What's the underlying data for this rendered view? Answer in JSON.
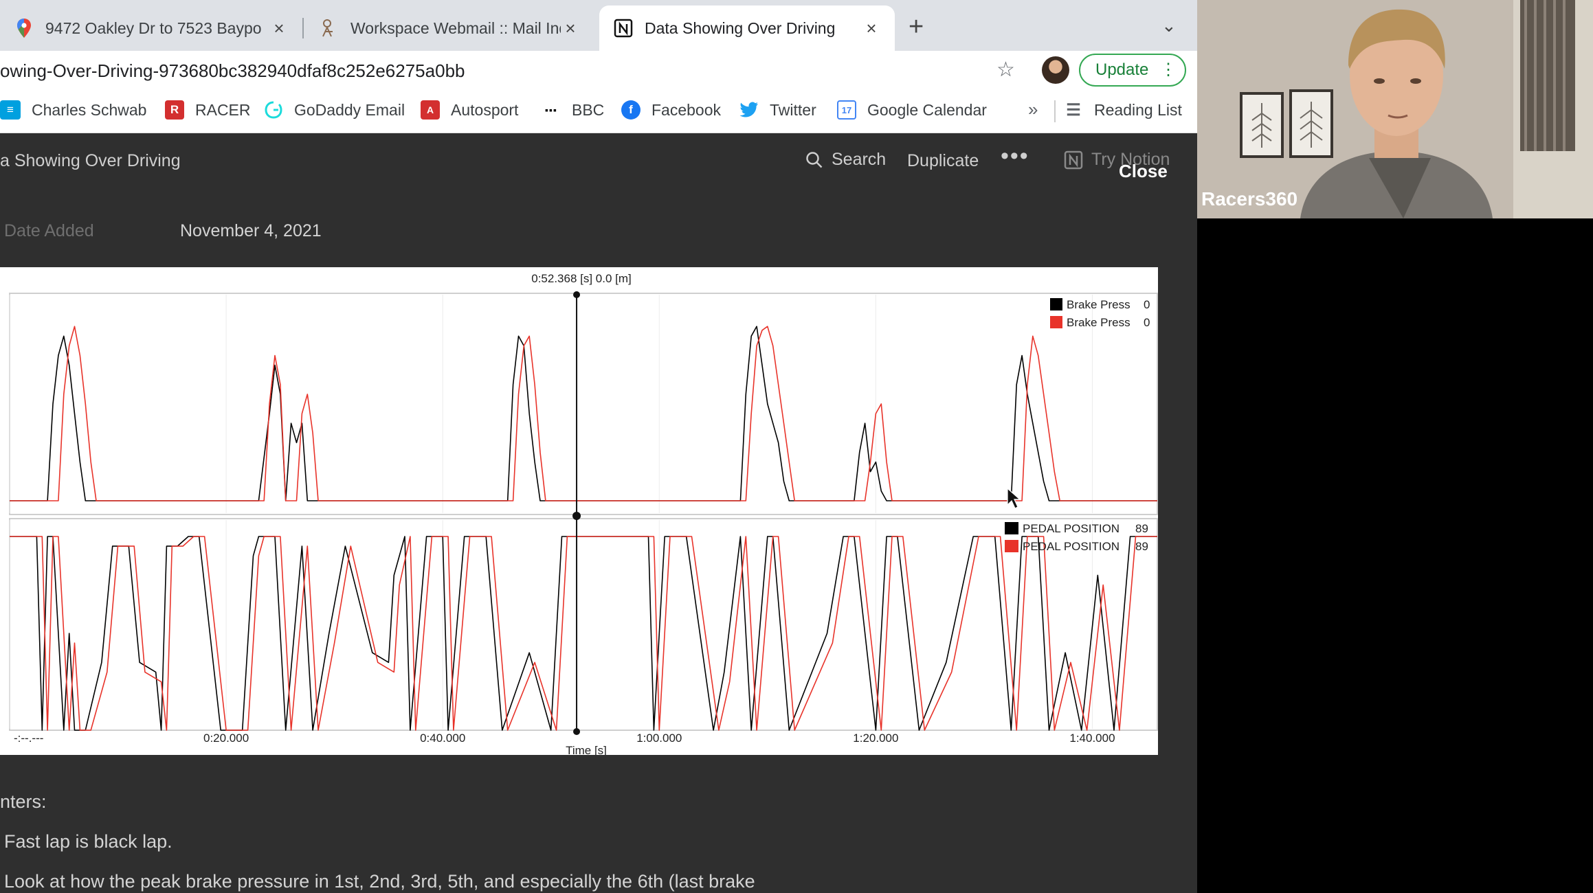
{
  "browser": {
    "tabs": [
      {
        "title": "9472 Oakley Dr to 7523 Baypo",
        "icon": "maps-pin-icon",
        "active": false
      },
      {
        "title": "Workspace Webmail :: Mail Ind",
        "icon": "webmail-icon",
        "active": false
      },
      {
        "title": "Data Showing Over Driving",
        "icon": "notion-icon",
        "active": true
      }
    ],
    "new_tab": "+",
    "tab_menu": "⌄",
    "url": "owing-Over-Driving-973680bc382940dfaf8c252e6275a0bb",
    "update_label": "Update",
    "bookmarks": [
      {
        "label": "Charles Schwab",
        "icon": "schwab-icon",
        "color": "#00a0df"
      },
      {
        "label": "RACER",
        "icon": "racer-icon",
        "color": "#d32f2f"
      },
      {
        "label": "GoDaddy Email",
        "icon": "godaddy-icon",
        "color": "#1bdbdb"
      },
      {
        "label": "Autosport",
        "icon": "autosport-icon",
        "color": "#d32f2f"
      },
      {
        "label": "BBC",
        "icon": "bbc-icon",
        "color": "#000000"
      },
      {
        "label": "Facebook",
        "icon": "facebook-icon",
        "color": "#1877f2"
      },
      {
        "label": "Twitter",
        "icon": "twitter-icon",
        "color": "#1da1f2"
      },
      {
        "label": "Google Calendar",
        "icon": "calendar-icon",
        "color": "#4285f4"
      }
    ],
    "bookmarks_overflow": "»",
    "reading_list": "Reading List"
  },
  "notion": {
    "breadcrumb": "a Showing Over Driving",
    "search": "Search",
    "duplicate": "Duplicate",
    "more": "•••",
    "try_notion": "Try Notion",
    "close": "Close",
    "property_label": "Date Added",
    "property_value": "November 4, 2021",
    "notes_heading": "nters:",
    "note_1": "Fast lap is black lap.",
    "note_2": "Look at how the peak brake pressure in 1st, 2nd, 3rd, 5th, and especially the 6th (last brake"
  },
  "webcam": {
    "name": "Racers360"
  },
  "chart_data": [
    {
      "type": "line",
      "title": "0:52.368 [s] 0.0 [m]",
      "xlabel": "Time [s]",
      "x_ticks": [
        "-:--.---",
        "0:20.000",
        "0:40.000",
        "1:00.000",
        "1:20.000",
        "1:40.000"
      ],
      "xlim": [
        0,
        106
      ],
      "ylim": [
        0,
        100
      ],
      "cursor_x": 52.368,
      "legend_position": "top-right",
      "series": [
        {
          "name": "Brake Press",
          "legend_value": "0",
          "color": "#000000",
          "x": [
            0,
            3.5,
            4,
            4.5,
            5,
            5.5,
            6,
            6.5,
            7,
            7.5,
            8,
            23,
            24,
            24.5,
            25,
            25.5,
            26,
            26.5,
            27,
            27.5,
            28,
            46,
            46.5,
            47,
            47.5,
            48,
            48.5,
            49,
            67.5,
            68,
            68.5,
            69,
            69.5,
            70,
            70.5,
            71,
            71.5,
            72,
            78,
            78.5,
            79,
            79.5,
            80,
            80.5,
            81,
            92.5,
            93,
            93.5,
            94,
            94.5,
            95,
            95.5,
            96,
            106
          ],
          "y": [
            0,
            0,
            50,
            75,
            85,
            70,
            45,
            20,
            0,
            0,
            0,
            0,
            45,
            70,
            55,
            0,
            40,
            30,
            40,
            0,
            0,
            0,
            60,
            85,
            80,
            45,
            20,
            0,
            0,
            55,
            85,
            90,
            70,
            50,
            40,
            30,
            10,
            0,
            0,
            25,
            40,
            15,
            20,
            5,
            0,
            0,
            60,
            75,
            55,
            40,
            25,
            10,
            0,
            0
          ]
        },
        {
          "name": "Brake Press",
          "legend_value": "0",
          "color": "#e8332a",
          "x": [
            0,
            4.5,
            5,
            5.5,
            6,
            6.5,
            7,
            7.5,
            8,
            23.5,
            24,
            24.5,
            25,
            25.5,
            26.5,
            27,
            27.5,
            28,
            28.5,
            46.5,
            47,
            47.5,
            48,
            48.5,
            49,
            49.5,
            68,
            68.5,
            69,
            69.5,
            70,
            70.5,
            71,
            71.5,
            72,
            72.5,
            79,
            79.5,
            80,
            80.5,
            81,
            81.5,
            93.5,
            94,
            94.5,
            95,
            95.5,
            96,
            96.5,
            97,
            106
          ],
          "y": [
            0,
            0,
            55,
            80,
            90,
            75,
            50,
            20,
            0,
            0,
            50,
            75,
            60,
            0,
            0,
            45,
            55,
            35,
            0,
            0,
            55,
            80,
            85,
            60,
            25,
            0,
            0,
            45,
            80,
            88,
            90,
            80,
            60,
            40,
            20,
            0,
            0,
            20,
            45,
            50,
            20,
            0,
            0,
            60,
            85,
            75,
            55,
            35,
            15,
            0,
            0
          ]
        }
      ]
    },
    {
      "type": "line",
      "xlabel": "Time [s]",
      "xlim": [
        0,
        106
      ],
      "ylim": [
        0,
        100
      ],
      "legend_position": "top-right",
      "series": [
        {
          "name": "PEDAL POSITION",
          "legend_value": "89",
          "color": "#000000",
          "x": [
            0,
            2.5,
            3,
            3.5,
            4,
            5,
            5.5,
            6,
            7,
            8.5,
            9.5,
            11,
            12,
            13.5,
            14,
            14.5,
            15.5,
            16.5,
            17.5,
            19.5,
            21.5,
            22.5,
            23,
            24.5,
            25.5,
            27,
            28,
            29.5,
            31,
            33.5,
            35,
            35.5,
            36.5,
            37,
            38.5,
            40,
            40.5,
            42,
            44,
            45.5,
            48,
            50,
            51,
            51.5,
            53,
            56,
            59,
            59.5,
            60.5,
            61,
            62.5,
            65,
            66,
            67.5,
            68.5,
            70,
            70.5,
            72,
            75.5,
            77,
            78,
            80,
            81,
            82,
            84,
            86.5,
            89,
            91,
            92.5,
            93.5,
            95,
            96,
            97.5,
            99,
            100.5,
            102,
            103.5,
            106
          ],
          "y": [
            100,
            100,
            0,
            100,
            100,
            0,
            50,
            0,
            0,
            35,
            95,
            95,
            35,
            30,
            0,
            95,
            95,
            100,
            100,
            0,
            0,
            90,
            100,
            100,
            0,
            95,
            0,
            50,
            95,
            40,
            35,
            80,
            100,
            0,
            100,
            100,
            0,
            100,
            100,
            0,
            40,
            0,
            100,
            100,
            100,
            100,
            100,
            0,
            100,
            100,
            100,
            0,
            30,
            100,
            0,
            100,
            100,
            0,
            50,
            100,
            100,
            0,
            100,
            100,
            0,
            35,
            100,
            100,
            0,
            100,
            100,
            0,
            40,
            0,
            80,
            0,
            100,
            100
          ]
        },
        {
          "name": "PEDAL POSITION",
          "legend_value": "89",
          "color": "#e8332a",
          "x": [
            0,
            3,
            3.5,
            4,
            4.5,
            5.5,
            6,
            6.5,
            7.5,
            9,
            10,
            11.5,
            12.5,
            14,
            14.5,
            15,
            16,
            17,
            18,
            20,
            22,
            23,
            23.5,
            25,
            26,
            27.5,
            28.5,
            30,
            31.5,
            34,
            35.5,
            36,
            37,
            37.5,
            39,
            40.5,
            41,
            42.5,
            44.5,
            46,
            48.5,
            50.5,
            51.5,
            52,
            53.5,
            56.5,
            59.5,
            60,
            61,
            61.5,
            63,
            65.5,
            66.5,
            68,
            69,
            70.5,
            71,
            72.5,
            76,
            77.5,
            78.5,
            80.5,
            81.5,
            82.5,
            84.5,
            87,
            89.5,
            91.5,
            93,
            94,
            95.5,
            96.5,
            98,
            99.5,
            101,
            102.5,
            104,
            106
          ],
          "y": [
            100,
            100,
            0,
            100,
            100,
            0,
            45,
            0,
            0,
            30,
            95,
            95,
            30,
            25,
            0,
            95,
            95,
            100,
            100,
            0,
            0,
            90,
            100,
            100,
            0,
            95,
            0,
            45,
            95,
            35,
            30,
            75,
            100,
            0,
            100,
            100,
            0,
            100,
            100,
            0,
            35,
            0,
            100,
            100,
            100,
            100,
            100,
            0,
            100,
            100,
            100,
            0,
            25,
            100,
            0,
            100,
            100,
            0,
            45,
            100,
            100,
            0,
            100,
            100,
            0,
            30,
            100,
            100,
            0,
            100,
            100,
            0,
            35,
            0,
            75,
            0,
            100,
            100
          ]
        }
      ]
    }
  ],
  "colors": {
    "notion_bg": "#2f2f2f",
    "update_green": "#188038",
    "lap_black": "#000000",
    "lap_red": "#e8332a"
  }
}
